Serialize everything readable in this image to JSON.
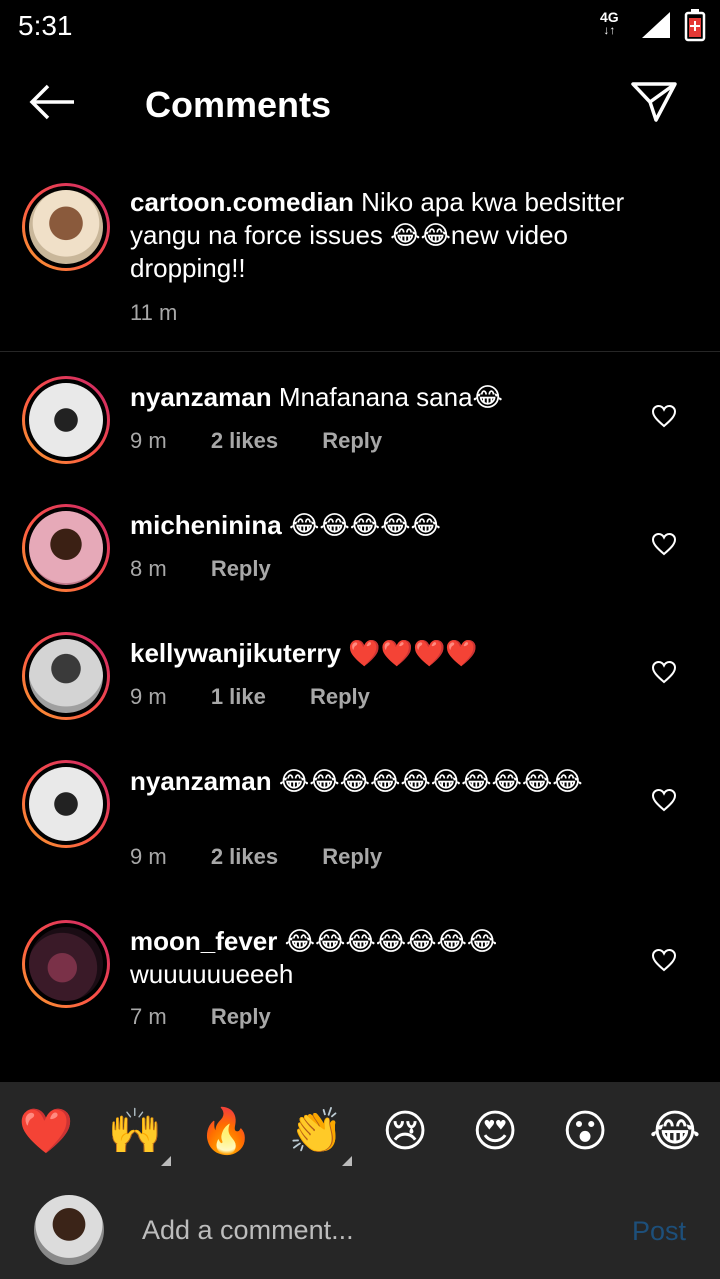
{
  "status": {
    "time": "5:31",
    "network": "4G"
  },
  "header": {
    "title": "Comments"
  },
  "caption": {
    "username": "cartoon.comedian",
    "text": "Niko apa kwa bedsitter yangu na force issues 😂😂new video dropping!!",
    "time": "11 m"
  },
  "comments": [
    {
      "username": "nyanzaman",
      "text": "Mnafanana sana😂",
      "time": "9 m",
      "likes": "2 likes",
      "reply": "Reply"
    },
    {
      "username": "micheninina",
      "text": "😂😂😂😂😂",
      "time": "8 m",
      "likes": "",
      "reply": "Reply"
    },
    {
      "username": "kellywanjikuterry",
      "text": "❤️❤️❤️❤️",
      "time": "9 m",
      "likes": "1 like",
      "reply": "Reply"
    },
    {
      "username": "nyanzaman",
      "text": "😂😂😂😂😂😂😂😂😂😂",
      "time": "9 m",
      "likes": "2 likes",
      "reply": "Reply"
    },
    {
      "username": "moon_fever",
      "text": "😂😂😂😂😂😂😂 wuuuuuueeeh",
      "time": "7 m",
      "likes": "",
      "reply": "Reply"
    }
  ],
  "reactions": [
    "❤️",
    "🙌",
    "🔥",
    "👏",
    "😢",
    "😍",
    "😮",
    "😂"
  ],
  "composer": {
    "placeholder": "Add a comment...",
    "post_label": "Post"
  },
  "colors": {
    "background": "#000000",
    "panel": "#262626",
    "post_disabled": "#1d4f7a",
    "muted_text": "#a8a8a8"
  }
}
